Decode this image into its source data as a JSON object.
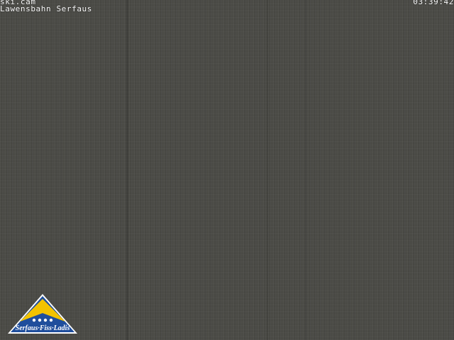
{
  "webcam": {
    "title": "ski.cam",
    "location": "Lawensbahn Serfaus",
    "time": "03:39:42"
  },
  "logo": {
    "text": "Serfaus·Fiss·Ladis",
    "colors": {
      "triangle_outer": "#ffffff",
      "triangle_blue": "#1f4e9c",
      "triangle_yellow": "#f2c200"
    }
  }
}
